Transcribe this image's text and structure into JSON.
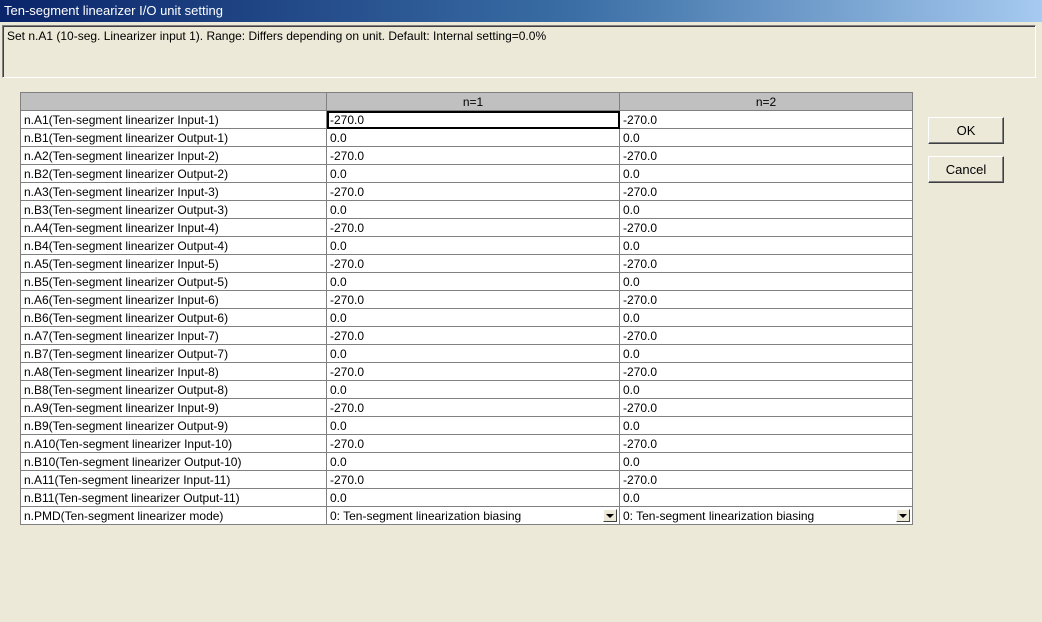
{
  "window": {
    "title": "Ten-segment linearizer I/O unit setting"
  },
  "description": "Set n.A1 (10-seg. Linearizer input 1).  Range: Differs depending on unit.  Default: Internal setting=0.0%",
  "columns": [
    "n=1",
    "n=2"
  ],
  "rows": [
    {
      "label": "n.A1(Ten-segment linearizer Input-1)",
      "v1": "-270.0",
      "v2": "-270.0"
    },
    {
      "label": "n.B1(Ten-segment linearizer Output-1)",
      "v1": "0.0",
      "v2": "0.0"
    },
    {
      "label": "n.A2(Ten-segment linearizer Input-2)",
      "v1": "-270.0",
      "v2": "-270.0"
    },
    {
      "label": "n.B2(Ten-segment linearizer Output-2)",
      "v1": "0.0",
      "v2": "0.0"
    },
    {
      "label": "n.A3(Ten-segment linearizer Input-3)",
      "v1": "-270.0",
      "v2": "-270.0"
    },
    {
      "label": "n.B3(Ten-segment linearizer Output-3)",
      "v1": "0.0",
      "v2": "0.0"
    },
    {
      "label": "n.A4(Ten-segment linearizer Input-4)",
      "v1": "-270.0",
      "v2": "-270.0"
    },
    {
      "label": "n.B4(Ten-segment linearizer Output-4)",
      "v1": "0.0",
      "v2": "0.0"
    },
    {
      "label": "n.A5(Ten-segment linearizer Input-5)",
      "v1": "-270.0",
      "v2": "-270.0"
    },
    {
      "label": "n.B5(Ten-segment linearizer Output-5)",
      "v1": "0.0",
      "v2": "0.0"
    },
    {
      "label": "n.A6(Ten-segment linearizer Input-6)",
      "v1": "-270.0",
      "v2": "-270.0"
    },
    {
      "label": "n.B6(Ten-segment linearizer Output-6)",
      "v1": "0.0",
      "v2": "0.0"
    },
    {
      "label": "n.A7(Ten-segment linearizer Input-7)",
      "v1": "-270.0",
      "v2": "-270.0"
    },
    {
      "label": "n.B7(Ten-segment linearizer Output-7)",
      "v1": "0.0",
      "v2": "0.0"
    },
    {
      "label": "n.A8(Ten-segment linearizer Input-8)",
      "v1": "-270.0",
      "v2": "-270.0"
    },
    {
      "label": "n.B8(Ten-segment linearizer Output-8)",
      "v1": "0.0",
      "v2": "0.0"
    },
    {
      "label": "n.A9(Ten-segment linearizer Input-9)",
      "v1": "-270.0",
      "v2": "-270.0"
    },
    {
      "label": "n.B9(Ten-segment linearizer Output-9)",
      "v1": "0.0",
      "v2": "0.0"
    },
    {
      "label": "n.A10(Ten-segment linearizer Input-10)",
      "v1": "-270.0",
      "v2": "-270.0"
    },
    {
      "label": "n.B10(Ten-segment linearizer Output-10)",
      "v1": "0.0",
      "v2": "0.0"
    },
    {
      "label": "n.A11(Ten-segment linearizer Input-11)",
      "v1": "-270.0",
      "v2": "-270.0"
    },
    {
      "label": "n.B11(Ten-segment linearizer Output-11)",
      "v1": "0.0",
      "v2": "0.0"
    }
  ],
  "mode_row": {
    "label": "n.PMD(Ten-segment linearizer mode)",
    "v1": "0: Ten-segment linearization biasing",
    "v2": "0: Ten-segment linearization biasing"
  },
  "buttons": {
    "ok": "OK",
    "cancel": "Cancel"
  }
}
